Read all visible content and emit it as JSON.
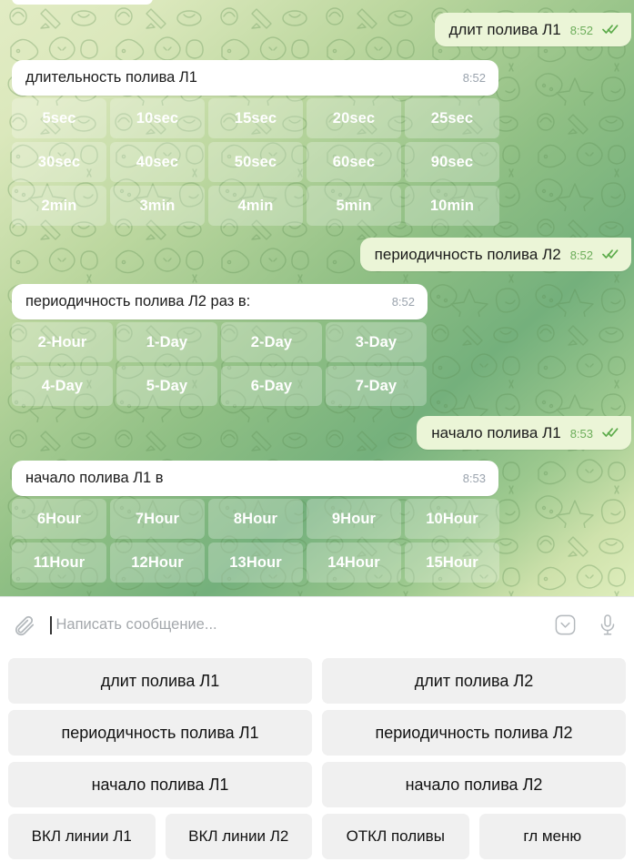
{
  "wallpaper": {
    "name": "telegram-doodle-pattern",
    "gradient_from": "#e2ecc4",
    "gradient_to": "#74b07c"
  },
  "chat": {
    "messages": [
      {
        "id": "m1",
        "direction": "outgoing",
        "text": "длит полива Л1",
        "time": "8:52",
        "status": "read"
      },
      {
        "id": "m2",
        "direction": "incoming",
        "text": "длительность полива Л1",
        "time": "8:52",
        "inline_keyboard": [
          [
            "5sec",
            "10sec",
            "15sec",
            "20sec",
            "25sec"
          ],
          [
            "30sec",
            "40sec",
            "50sec",
            "60sec",
            "90sec"
          ],
          [
            "2min",
            "3min",
            "4min",
            "5min",
            "10min"
          ]
        ]
      },
      {
        "id": "m3",
        "direction": "outgoing",
        "text": "периодичность полива Л2",
        "time": "8:52",
        "status": "read"
      },
      {
        "id": "m4",
        "direction": "incoming",
        "text": "периодичность полива Л2 раз в:",
        "time": "8:52",
        "inline_keyboard": [
          [
            "2-Hour",
            "1-Day",
            "2-Day",
            "3-Day"
          ],
          [
            "4-Day",
            "5-Day",
            "6-Day",
            "7-Day"
          ]
        ]
      },
      {
        "id": "m5",
        "direction": "outgoing",
        "text": "начало полива Л1",
        "time": "8:53",
        "status": "read"
      },
      {
        "id": "m6",
        "direction": "incoming",
        "text": "начало полива Л1 в",
        "time": "8:53",
        "inline_keyboard": [
          [
            "6Hour",
            "7Hour",
            "8Hour",
            "9Hour",
            "10Hour"
          ],
          [
            "11Hour",
            "12Hour",
            "13Hour",
            "14Hour",
            "15Hour"
          ]
        ]
      }
    ]
  },
  "input_bar": {
    "attach_icon": "paperclip-icon",
    "placeholder": "Написать сообщение...",
    "value": "",
    "keyboard_toggle_icon": "chevron-down-icon",
    "voice_icon": "microphone-icon"
  },
  "reply_keyboard": {
    "rows": [
      [
        "длит полива Л1",
        "длит полива Л2"
      ],
      [
        "периодичность полива Л1",
        "периодичность полива Л2"
      ],
      [
        "начало полива Л1",
        "начало полива Л2"
      ],
      [
        "ВКЛ линии Л1",
        "ВКЛ линии Л2",
        "ОТКЛ поливы",
        "гл меню"
      ]
    ]
  },
  "colors": {
    "outgoing_bubble": "#ebf5d7",
    "incoming_bubble": "#ffffff",
    "inline_button_text": "#ffffff",
    "reply_button_bg": "#f0f0f0",
    "tick_green": "#5cab4a",
    "time_out": "#6cad5a",
    "time_in": "#9aa3ad"
  }
}
